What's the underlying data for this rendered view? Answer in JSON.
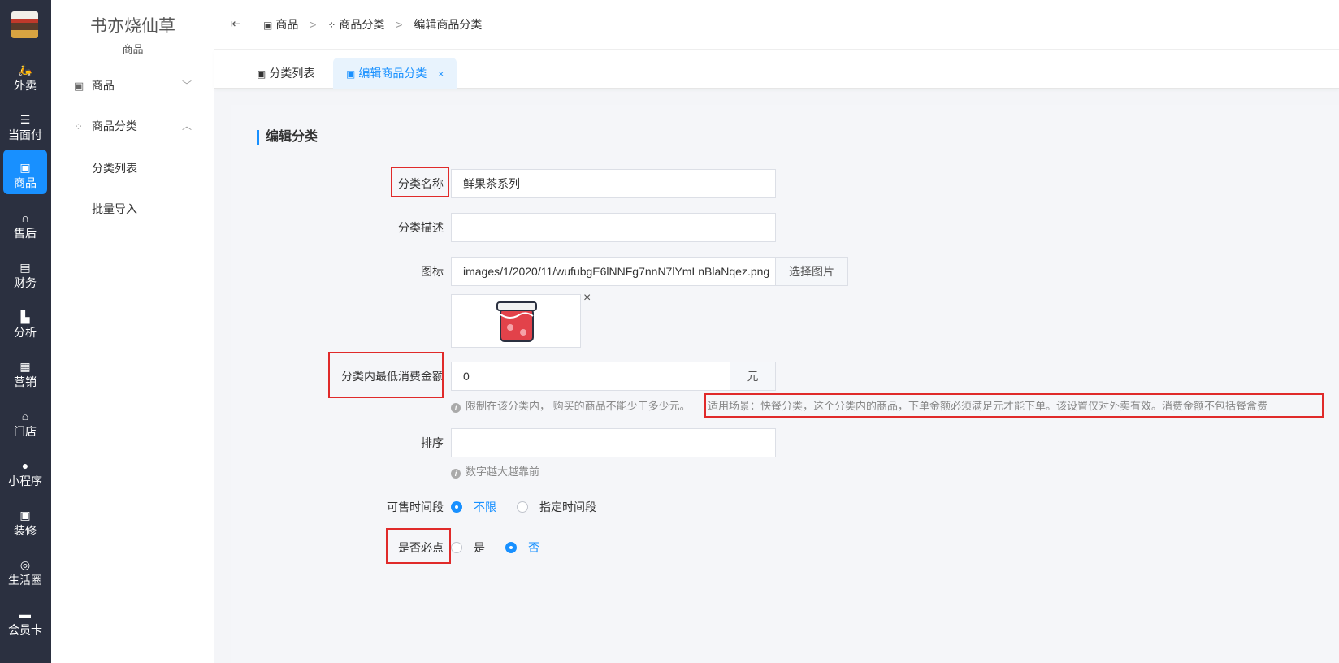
{
  "rail": {
    "items": [
      {
        "label": "外卖",
        "icon": "scooter-icon"
      },
      {
        "label": "当面付",
        "icon": "list-icon"
      },
      {
        "label": "商品",
        "icon": "basket-icon"
      },
      {
        "label": "售后",
        "icon": "headset-icon"
      },
      {
        "label": "财务",
        "icon": "finance-icon"
      },
      {
        "label": "分析",
        "icon": "chart-icon"
      },
      {
        "label": "营销",
        "icon": "gift-icon"
      },
      {
        "label": "门店",
        "icon": "store-icon"
      },
      {
        "label": "小程序",
        "icon": "wechat-icon"
      },
      {
        "label": "装修",
        "icon": "decorate-icon"
      },
      {
        "label": "生活圈",
        "icon": "lifebuoy-icon"
      },
      {
        "label": "会员卡",
        "icon": "card-icon"
      }
    ],
    "active_label": "商品"
  },
  "sidebar": {
    "store_name": "书亦烧仙草",
    "section": "商品",
    "groups": [
      {
        "label": "商品",
        "expanded": false
      },
      {
        "label": "商品分类",
        "expanded": true
      }
    ],
    "sub_items": [
      "分类列表",
      "批量导入"
    ]
  },
  "breadcrumb": {
    "items": [
      "商品",
      "商品分类",
      "编辑商品分类"
    ],
    "separator": ">"
  },
  "tabs": {
    "items": [
      {
        "label": "分类列表",
        "active": false
      },
      {
        "label": "编辑商品分类",
        "active": true,
        "closable": true
      }
    ],
    "close_glyph": "×"
  },
  "form": {
    "title": "编辑分类",
    "name_label": "分类名称",
    "name_value": "鲜果茶系列",
    "desc_label": "分类描述",
    "desc_value": "",
    "icon_label": "图标",
    "icon_value": "images/1/2020/11/wufubgE6lNNFg7nnN7lYmLnBlaNqez.png",
    "choose_image": "选择图片",
    "remove_glyph": "×",
    "min_label": "分类内最低消费金额",
    "min_value": "0",
    "min_unit": "元",
    "min_hint": "限制在该分类内， 购买的商品不能少于多少元。",
    "min_hint2": "适用场景：快餐分类，这个分类内的商品，下单金额必须满足元才能下单。该设置仅对外卖有效。消费金额不包括餐盒费",
    "sort_label": "排序",
    "sort_value": "",
    "sort_hint": "数字越大越靠前",
    "time_label": "可售时间段",
    "time_options": [
      {
        "label": "不限",
        "checked": true
      },
      {
        "label": "指定时间段",
        "checked": false
      }
    ],
    "required_label": "是否必点",
    "required_options": [
      {
        "label": "是",
        "checked": false
      },
      {
        "label": "否",
        "checked": true
      }
    ]
  },
  "colors": {
    "accent": "#1890ff",
    "rail_bg": "#2b3040",
    "highlight_box": "#e02a2a"
  }
}
